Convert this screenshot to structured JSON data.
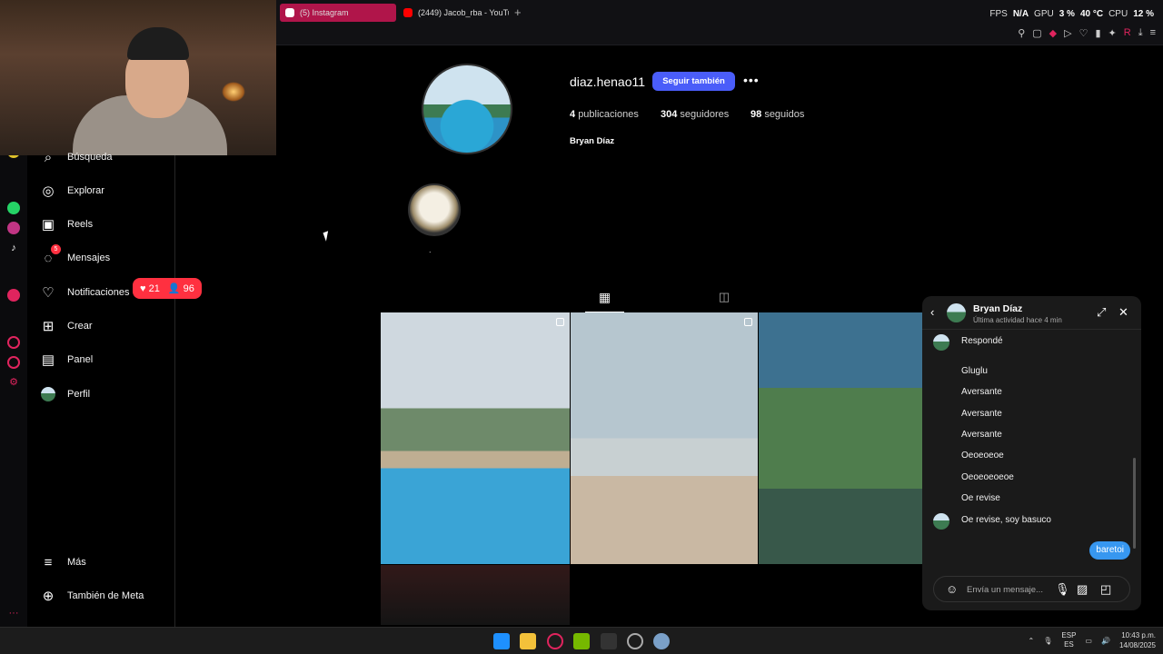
{
  "browser": {
    "tabs": [
      {
        "label": "(5) Instagram",
        "active": true,
        "color": "#b0154a"
      },
      {
        "label": "(2449) Jacob_rba - YouTube",
        "active": false,
        "color": "#ff0000"
      }
    ],
    "new_tab_icon": "plus-icon",
    "stats": {
      "fps_label": "FPS",
      "fps_value": "N/A",
      "gpu_label": "GPU",
      "gpu_value": "3 %",
      "gpu_temp": "40 °C",
      "cpu_label": "CPU",
      "cpu_value": "12 %"
    }
  },
  "sidebar": {
    "items": [
      {
        "label": "Búsqueda",
        "icon": "search-icon"
      },
      {
        "label": "Explorar",
        "icon": "compass-icon"
      },
      {
        "label": "Reels",
        "icon": "reels-icon"
      },
      {
        "label": "Mensajes",
        "icon": "messenger-icon",
        "badge": "5"
      },
      {
        "label": "Notificaciones",
        "icon": "heart-icon"
      },
      {
        "label": "Crear",
        "icon": "plus-square-icon"
      },
      {
        "label": "Panel",
        "icon": "chart-icon"
      },
      {
        "label": "Perfil",
        "icon": "avatar"
      }
    ],
    "more_label": "Más",
    "meta_label": "También de Meta",
    "notification_pill": {
      "likes": "21",
      "followers": "96"
    }
  },
  "profile": {
    "username": "diaz.henao11",
    "follow_label": "Seguir también",
    "posts_count": "4",
    "posts_label": "publicaciones",
    "followers_count": "304",
    "followers_label": "seguidores",
    "following_count": "98",
    "following_label": "seguidos",
    "full_name": "Bryan Díaz",
    "highlight_label": "."
  },
  "dm": {
    "name": "Bryan Díaz",
    "status": "Última actividad hace 4 min",
    "messages": [
      {
        "text": "Respondé",
        "avatar": true
      },
      {
        "text": "Gluglu",
        "avatar": false
      },
      {
        "text": "Aversante",
        "avatar": false
      },
      {
        "text": "Aversante",
        "avatar": false
      },
      {
        "text": "Aversante",
        "avatar": false
      },
      {
        "text": "Oeoeoeoe",
        "avatar": false
      },
      {
        "text": "Oeoeoeoeoe",
        "avatar": false
      },
      {
        "text": "Oe revise",
        "avatar": false
      },
      {
        "text": "Oe revise, soy basuco",
        "avatar": true
      }
    ],
    "my_message": "baretoi",
    "input_placeholder": "Envía un mensaje..."
  },
  "taskbar": {
    "lang": "ESP",
    "region": "ES",
    "time": "10:43 p.m.",
    "date": "14/08/2025"
  }
}
